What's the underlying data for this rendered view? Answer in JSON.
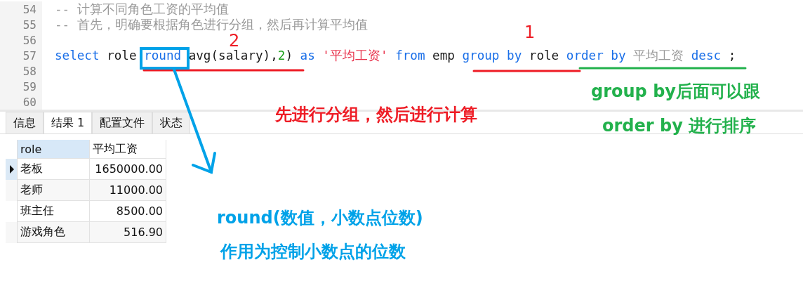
{
  "editor": {
    "lines": [
      {
        "number": "54",
        "tokens": [
          {
            "kind": "comment",
            "text": "-- 计算不同角色工资的平均值"
          }
        ]
      },
      {
        "number": "55",
        "tokens": [
          {
            "kind": "comment",
            "text": "-- 首先，明确要根据角色进行分组，然后再计算平均值"
          }
        ]
      },
      {
        "number": "56"
      },
      {
        "number": "57",
        "tokens": [
          {
            "kind": "keyword",
            "text": "select"
          },
          {
            "kind": "plain",
            "text": " role "
          },
          {
            "kind": "keyword",
            "text": "round"
          },
          {
            "kind": "plain",
            "text": " avg(salary),"
          },
          {
            "kind": "number",
            "text": "2"
          },
          {
            "kind": "plain",
            "text": ") "
          },
          {
            "kind": "keyword",
            "text": "as "
          },
          {
            "kind": "string",
            "text": "'平均工资' "
          },
          {
            "kind": "keyword",
            "text": "from"
          },
          {
            "kind": "plain",
            "text": " emp "
          },
          {
            "kind": "keyword",
            "text": "group by"
          },
          {
            "kind": "plain",
            "text": " role "
          },
          {
            "kind": "keyword",
            "text": "order by "
          },
          {
            "kind": "comment",
            "text": "平均工资 "
          },
          {
            "kind": "keyword",
            "text": "desc"
          },
          {
            "kind": "plain",
            "text": " ;"
          }
        ]
      },
      {
        "number": "58"
      },
      {
        "number": "59"
      },
      {
        "number": "60"
      }
    ]
  },
  "tabs": [
    {
      "label": "信息",
      "selected": false
    },
    {
      "label": "结果 1",
      "selected": true
    },
    {
      "label": "配置文件",
      "selected": false
    },
    {
      "label": "状态",
      "selected": false
    }
  ],
  "table": {
    "columns": [
      "role",
      "平均工资"
    ],
    "rows": [
      {
        "cells": [
          "老板",
          "1650000.00"
        ],
        "selected": true
      },
      {
        "cells": [
          "老师",
          "11000.00"
        ],
        "selected": false
      },
      {
        "cells": [
          "班主任",
          "8500.00"
        ],
        "selected": false
      },
      {
        "cells": [
          "游戏角色",
          "516.90"
        ],
        "selected": false
      }
    ]
  },
  "annotations": [
    {
      "kind": "marker",
      "text": "2",
      "color": "#ee1c25"
    },
    {
      "kind": "marker",
      "text": "1",
      "color": "#ee1c25"
    },
    {
      "kind": "note",
      "text": "先进行分组，然后进行计算",
      "color": "#ee1c25"
    },
    {
      "kind": "note",
      "text": "group by后面可以跟",
      "color": "#22b14c"
    },
    {
      "kind": "note",
      "text": "order by 进行排序",
      "color": "#22b14c"
    },
    {
      "kind": "note",
      "text": "round(数值，小数点位数)",
      "color": "#00a2e8"
    },
    {
      "kind": "note",
      "text": "作用为控制小数点的位数",
      "color": "#00a2e8"
    }
  ]
}
